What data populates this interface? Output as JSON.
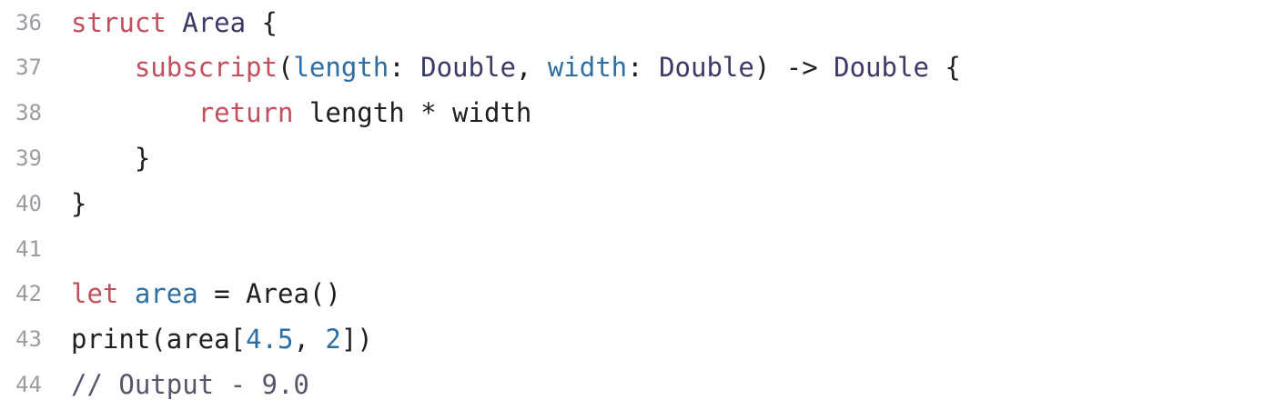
{
  "editor": {
    "lines": [
      {
        "number": "36",
        "tokens": [
          [
            "kw",
            "struct"
          ],
          [
            "plain",
            " "
          ],
          [
            "type",
            "Area"
          ],
          [
            "plain",
            " {"
          ]
        ]
      },
      {
        "number": "37",
        "tokens": [
          [
            "plain",
            "    "
          ],
          [
            "kw",
            "subscript"
          ],
          [
            "plain",
            "("
          ],
          [
            "ident",
            "length"
          ],
          [
            "plain",
            ": "
          ],
          [
            "type",
            "Double"
          ],
          [
            "plain",
            ", "
          ],
          [
            "ident",
            "width"
          ],
          [
            "plain",
            ": "
          ],
          [
            "type",
            "Double"
          ],
          [
            "plain",
            ") -> "
          ],
          [
            "type",
            "Double"
          ],
          [
            "plain",
            " {"
          ]
        ]
      },
      {
        "number": "38",
        "tokens": [
          [
            "plain",
            "        "
          ],
          [
            "kw",
            "return"
          ],
          [
            "plain",
            " length * width"
          ]
        ]
      },
      {
        "number": "39",
        "tokens": [
          [
            "plain",
            "    }"
          ]
        ]
      },
      {
        "number": "40",
        "tokens": [
          [
            "plain",
            "}"
          ]
        ]
      },
      {
        "number": "41",
        "tokens": []
      },
      {
        "number": "42",
        "tokens": [
          [
            "kw",
            "let"
          ],
          [
            "plain",
            " "
          ],
          [
            "ident",
            "area"
          ],
          [
            "plain",
            " = Area()"
          ]
        ]
      },
      {
        "number": "43",
        "tokens": [
          [
            "plain",
            "print(area["
          ],
          [
            "num",
            "4.5"
          ],
          [
            "plain",
            ", "
          ],
          [
            "num",
            "2"
          ],
          [
            "plain",
            "])"
          ]
        ]
      },
      {
        "number": "44",
        "tokens": [
          [
            "comment",
            "// Output - 9.0"
          ]
        ]
      }
    ]
  },
  "colors": {
    "keyword": "#c0505e",
    "type": "#3b3a67",
    "identifier": "#2f6ea3",
    "number": "#2f6ea3",
    "plain": "#1f1f24",
    "comment": "#56566b",
    "line_number": "#9b9ba3",
    "background": "#ffffff"
  }
}
